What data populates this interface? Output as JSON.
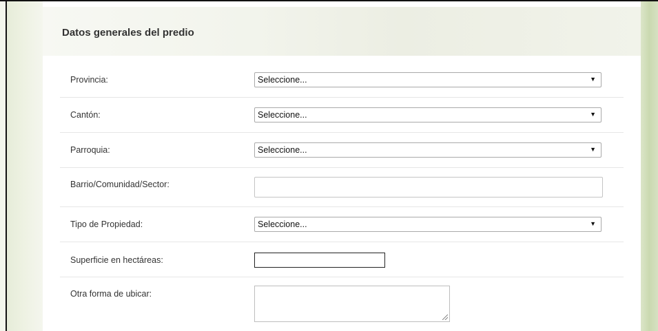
{
  "section": {
    "title": "Datos generales del predio"
  },
  "fields": {
    "provincia": {
      "label": "Provincia:",
      "value": "Seleccione..."
    },
    "canton": {
      "label": "Cantón:",
      "value": "Seleccione..."
    },
    "parroquia": {
      "label": "Parroquia:",
      "value": "Seleccione..."
    },
    "barrio": {
      "label": "Barrio/Comunidad/Sector:",
      "value": ""
    },
    "tipo_propiedad": {
      "label": "Tipo de Propiedad:",
      "value": "Seleccione..."
    },
    "superficie": {
      "label": "Superficie en hectáreas:",
      "value": ""
    },
    "otra_forma": {
      "label": "Otra forma de ubicar:",
      "value": ""
    }
  },
  "icons": {
    "dropdown": "chevron-down-icon",
    "resize": "resize-grip-icon"
  }
}
